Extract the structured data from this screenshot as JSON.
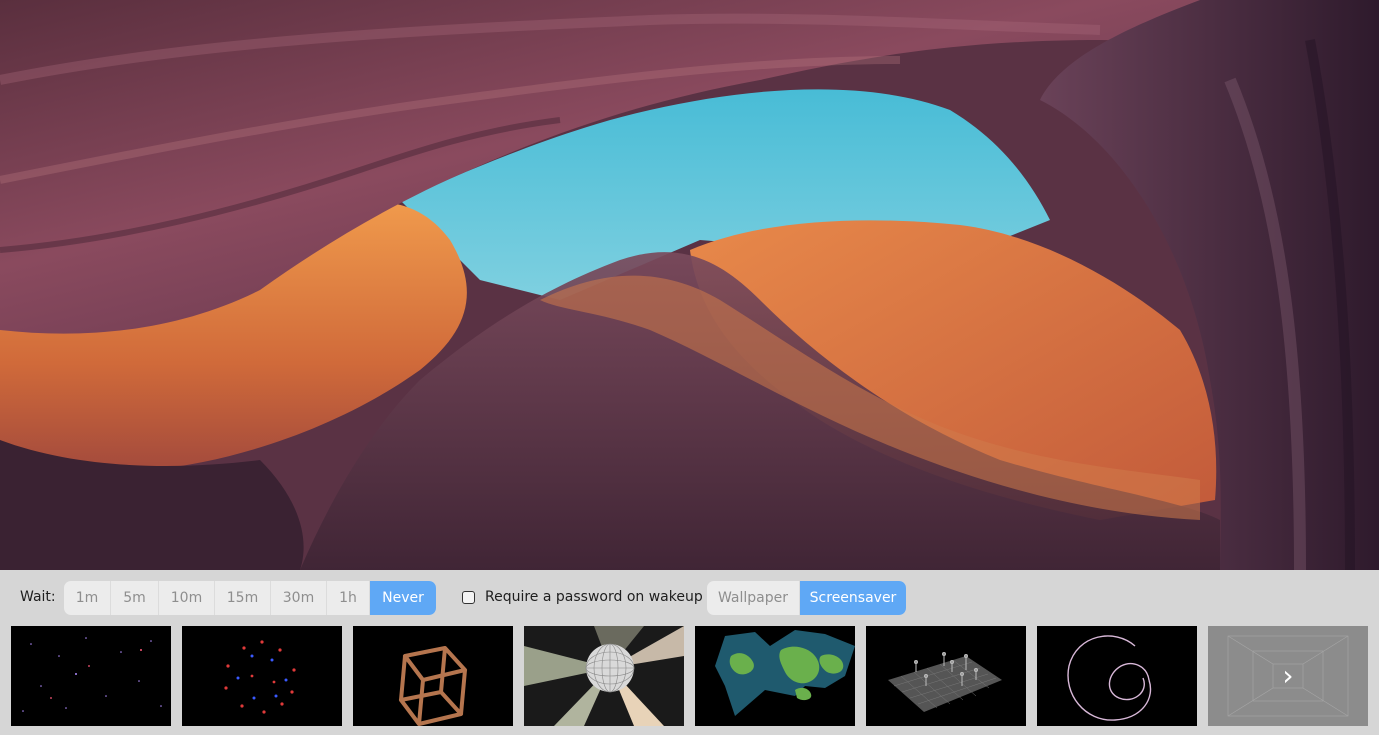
{
  "wallpaper": {
    "description_icon": "canyon-wallpaper-image"
  },
  "controls": {
    "wait_label": "Wait:",
    "wait_options": [
      "1m",
      "5m",
      "10m",
      "15m",
      "30m",
      "1h",
      "Never"
    ],
    "wait_selected": "Never",
    "password_label": "Require a password on wakeup",
    "password_checked": false,
    "mode_options": [
      "Wallpaper",
      "Screensaver"
    ],
    "mode_selected": "Screensaver"
  },
  "thumbnails": [
    {
      "icon": "starfield-icon"
    },
    {
      "icon": "particle-sphere-icon"
    },
    {
      "icon": "wireframe-cube-icon"
    },
    {
      "icon": "disco-ball-icon"
    },
    {
      "icon": "world-map-icon"
    },
    {
      "icon": "grid-plane-icon"
    },
    {
      "icon": "spiral-curve-icon"
    },
    {
      "icon": "next-page-icon"
    }
  ],
  "colors": {
    "accent": "#5fa8f5",
    "bar_background": "#d6d6d6",
    "segment_background": "#ececec",
    "sky": "#4fc0d8"
  }
}
